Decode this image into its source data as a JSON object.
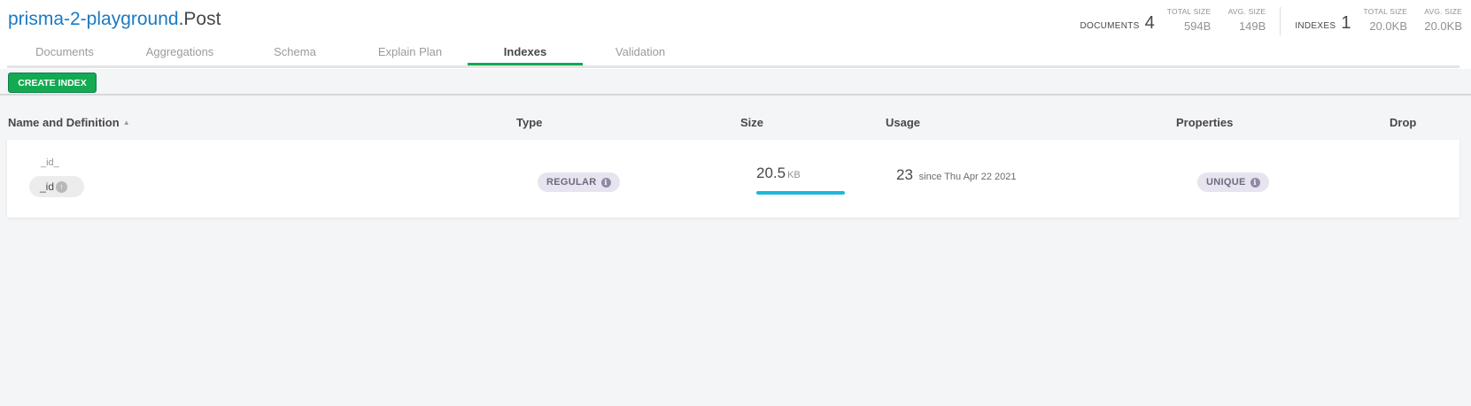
{
  "namespace": {
    "database": "prisma-2-playground",
    "collection": ".Post"
  },
  "stats": {
    "documents": {
      "label": "DOCUMENTS",
      "count": "4",
      "total_size_label": "TOTAL SIZE",
      "total_size": "594B",
      "avg_size_label": "AVG. SIZE",
      "avg_size": "149B"
    },
    "indexes": {
      "label": "INDEXES",
      "count": "1",
      "total_size_label": "TOTAL SIZE",
      "total_size": "20.0KB",
      "avg_size_label": "AVG. SIZE",
      "avg_size": "20.0KB"
    }
  },
  "tabs": [
    {
      "label": "Documents",
      "active": false
    },
    {
      "label": "Aggregations",
      "active": false
    },
    {
      "label": "Schema",
      "active": false
    },
    {
      "label": "Explain Plan",
      "active": false
    },
    {
      "label": "Indexes",
      "active": true
    },
    {
      "label": "Validation",
      "active": false
    }
  ],
  "toolbar": {
    "create_index_label": "CREATE INDEX"
  },
  "columns": {
    "name": "Name and Definition",
    "type": "Type",
    "size": "Size",
    "usage": "Usage",
    "properties": "Properties",
    "drop": "Drop"
  },
  "indexes": [
    {
      "name": "_id_",
      "field": "_id",
      "type": "REGULAR",
      "size_value": "20.5",
      "size_unit": "KB",
      "size_fraction": 1.0,
      "usage_count": "23",
      "usage_since": "since Thu Apr 22 2021",
      "property": "UNIQUE"
    }
  ],
  "colors": {
    "accent": "#13aa52",
    "link": "#1a7ac4",
    "size_bar": "#1cb8de"
  },
  "icons": {
    "sort": "sort-ascending-icon",
    "info": "info-icon",
    "direction": "arrow-up-circle-icon"
  }
}
